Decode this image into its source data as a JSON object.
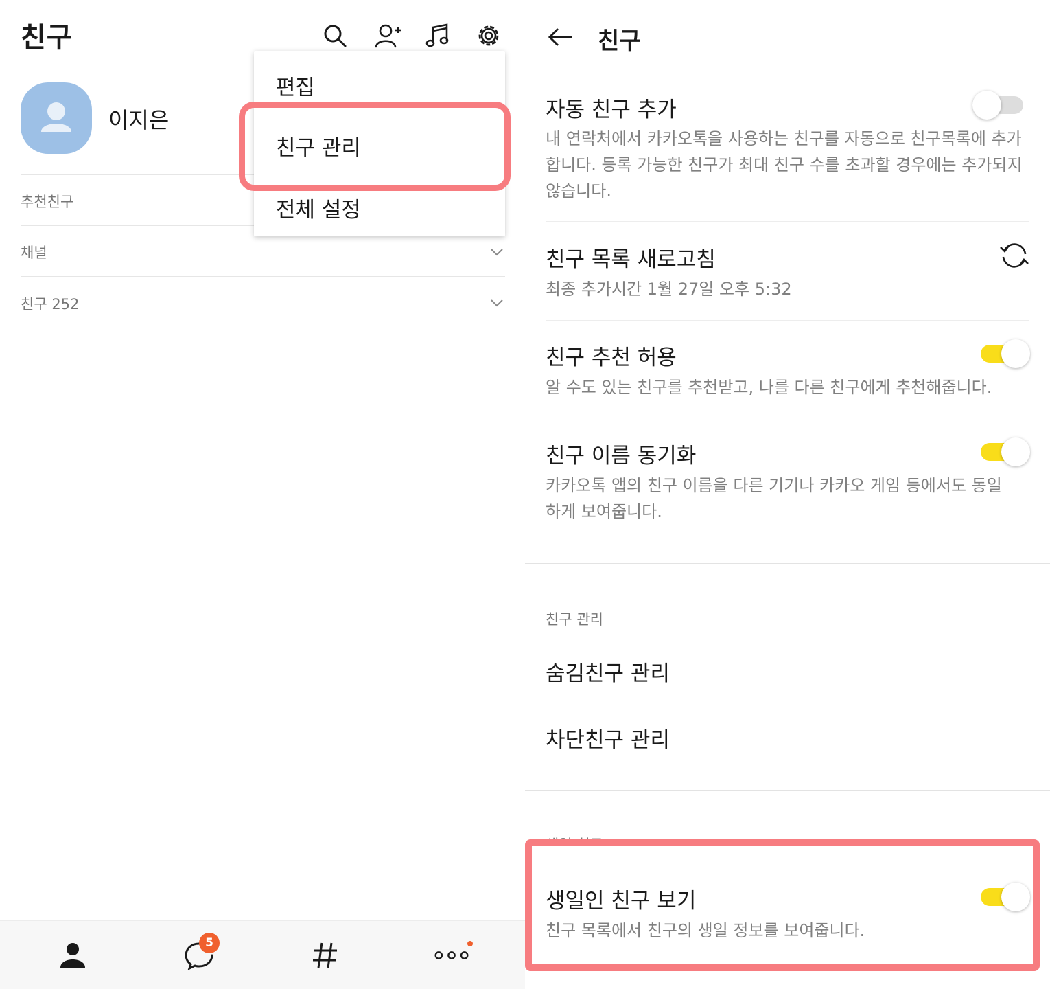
{
  "left": {
    "title": "친구",
    "profile": {
      "name": "이지은"
    },
    "sections": {
      "recommended": "추천친구",
      "channel": "채널",
      "friends": "친구 252"
    },
    "menu": {
      "items": [
        "편집",
        "친구 관리",
        "전체 설정"
      ]
    },
    "bottom_nav": {
      "chat_badge": "5"
    },
    "icons": {
      "search": "search-icon",
      "add_friend": "add-friend-icon",
      "music": "music-icon",
      "settings": "gear-icon",
      "people_tab": "person-icon",
      "chat_tab": "chat-bubble-icon",
      "openchat_tab": "hashtag-icon",
      "more_tab": "more-dots-icon"
    }
  },
  "right": {
    "title": "친구",
    "settings": {
      "auto_add": {
        "title": "자동 친구 추가",
        "desc": "내 연락처에서 카카오톡을 사용하는 친구를 자동으로 친구목록에 추가합니다. 등록 가능한 친구가 최대 친구 수를 초과할 경우에는 추가되지 않습니다.",
        "enabled": false
      },
      "refresh": {
        "title": "친구 목록 새로고침",
        "desc": "최종 추가시간 1월 27일 오후 5:32"
      },
      "recommend": {
        "title": "친구 추천 허용",
        "desc": "알 수도 있는 친구를 추천받고, 나를 다른 친구에게 추천해줍니다.",
        "enabled": true
      },
      "name_sync": {
        "title": "친구 이름 동기화",
        "desc": "카카오톡 앱의 친구 이름을 다른 기기나 카카오 게임 등에서도 동일하게 보여줍니다.",
        "enabled": true
      }
    },
    "manage_section": {
      "label": "친구 관리",
      "hidden": "숨김친구 관리",
      "blocked": "차단친구 관리"
    },
    "birthday_section": {
      "label": "생일 친구",
      "title": "생일인 친구 보기",
      "desc": "친구 목록에서 친구의 생일 정보를 보여줍니다.",
      "enabled": true
    }
  },
  "colors": {
    "highlight": "#f77c80",
    "toggle_on": "#f9dd1a",
    "badge": "#f0602e",
    "avatar": "#9dc0e6"
  }
}
